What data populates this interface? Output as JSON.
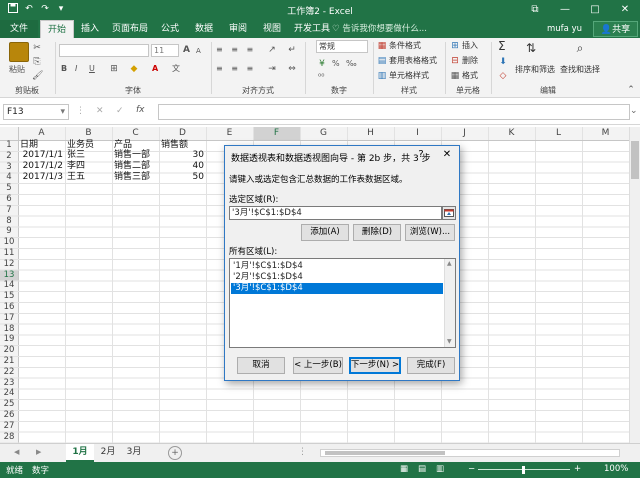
{
  "title_bar": {
    "title": "工作簿2 - Excel",
    "save_icon": "save-icon",
    "undo_icon": "undo-icon",
    "redo_icon": "redo-icon",
    "win_restore": "⧉",
    "win_min": "—",
    "win_max": "□",
    "win_close": "✕"
  },
  "ribbon_tabs": {
    "file": "文件",
    "items": [
      "开始",
      "插入",
      "页面布局",
      "公式",
      "数据",
      "审阅",
      "视图",
      "开发工具"
    ],
    "active": "开始",
    "tell_me": "告诉我你想要做什么...",
    "user": "mufa yu",
    "share": "共享"
  },
  "ribbon": {
    "groups": [
      "剪贴板",
      "字体",
      "对齐方式",
      "数字",
      "样式",
      "单元格",
      "编辑"
    ],
    "paste": "粘贴",
    "font_size": "11",
    "number_format": "常规",
    "styles": [
      "条件格式",
      "套用表格格式",
      "单元格样式"
    ],
    "cells": [
      "插入",
      "删除",
      "格式"
    ],
    "editing": [
      "排序和筛选",
      "查找和选择"
    ],
    "font_buttons": [
      "B",
      "I",
      "U"
    ],
    "grow_font": "A",
    "shrink_font": "A",
    "font_color": "A",
    "wubian": "文",
    "number_buttons": [
      "%",
      "‰",
      "⁰⁰"
    ],
    "sum": "Σ",
    "alignment_glyphs": "≡ ≡ ≡",
    "dropdown": "▾"
  },
  "formula_bar": {
    "name_box": "F13",
    "name_box_arrow": "▾",
    "cancel_icon": "✕",
    "enter_icon": "✓",
    "fx_label": "fx",
    "formula": "",
    "collapse_icon": "⌄"
  },
  "sheet": {
    "columns": [
      "A",
      "B",
      "C",
      "D",
      "E",
      "F",
      "G",
      "H",
      "I",
      "J",
      "K",
      "L",
      "M"
    ],
    "active_column": "F",
    "active_row": 13,
    "row_count": 28,
    "cells": [
      [
        "日期",
        "业务员",
        "产品",
        "销售额"
      ],
      [
        "2017/1/1",
        "张三",
        "销售一部",
        "30"
      ],
      [
        "2017/1/2",
        "李四",
        "销售二部",
        "40"
      ],
      [
        "2017/1/3",
        "王五",
        "销售三部",
        "50"
      ]
    ]
  },
  "sheet_tabs": {
    "tabs": [
      "1月",
      "2月",
      "3月"
    ],
    "active": "1月",
    "add": "+",
    "prev": "◀",
    "next": "▶"
  },
  "status_bar": {
    "items": [
      "就绪",
      "数字"
    ],
    "zoom": "100%",
    "zoom_minus": "−",
    "zoom_plus": "+"
  },
  "dialog": {
    "title": "数据透视表和数据透视图向导 - 第 2b 步，共 3 步",
    "help": "?",
    "close": "✕",
    "instruction": "请键入或选定包含汇总数据的工作表数据区域。",
    "range_label": "选定区域(R):",
    "range_value": "'3月'!$C$1:$D$4",
    "add_button": "添加(A)",
    "delete_button": "删除(D)",
    "browse_button": "浏览(W)...",
    "list_label": "所有区域(L):",
    "list_items": [
      "'1月'!$C$1:$D$4",
      "'2月'!$C$1:$D$4",
      "'3月'!$C$1:$D$4"
    ],
    "selected_item": "'3月'!$C$1:$D$4",
    "cancel_button": "取消",
    "back_button": "< 上一步(B)",
    "next_button": "下一步(N) >",
    "finish_button": "完成(F)"
  }
}
